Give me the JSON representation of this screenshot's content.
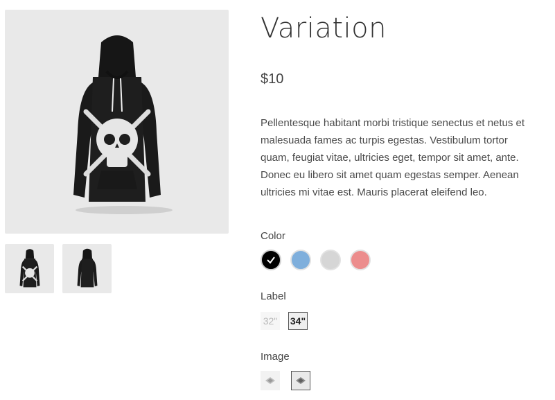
{
  "product": {
    "title": "Variation",
    "price": "$10",
    "description": "Pellentesque habitant morbi tristique senectus et netus et malesuada fames ac turpis egestas. Vestibulum tortor quam, feugiat vitae, ultricies eget, tempor sit amet, ante. Donec eu libero sit amet quam egestas semper. Aenean ultricies mi vitae est. Mauris placerat eleifend leo."
  },
  "gallery": {
    "main_image": "black-hoodie-front-skull",
    "thumbnails": [
      "black-hoodie-front",
      "black-hoodie-back"
    ]
  },
  "attributes": {
    "color": {
      "label": "Color",
      "options": [
        {
          "name": "black",
          "hex": "#000000",
          "selected": true
        },
        {
          "name": "blue",
          "hex": "#7fafdc",
          "selected": false
        },
        {
          "name": "gray",
          "hex": "#d6d6d6",
          "selected": false
        },
        {
          "name": "red",
          "hex": "#ec8d8d",
          "selected": false
        }
      ]
    },
    "label": {
      "label": "Label",
      "options": [
        {
          "text": "32\"",
          "selected": false
        },
        {
          "text": "34\"",
          "selected": true
        }
      ]
    },
    "image": {
      "label": "Image",
      "options": [
        {
          "name": "image-option-1",
          "selected": false
        },
        {
          "name": "image-option-2",
          "selected": true
        }
      ]
    }
  }
}
